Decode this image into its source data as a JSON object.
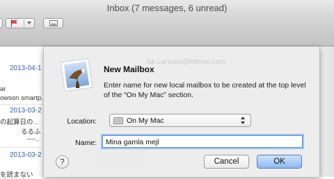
{
  "window": {
    "title": "Inbox (7 messages, 6 unread)"
  },
  "toolbar": {
    "flag_icon": "flag-icon",
    "photo_icon": "photo-browser-icon"
  },
  "message_list": {
    "items": [
      {
        "date": "2013-04-1",
        "lines": [
          "ar",
          "owson smartp..."
        ]
      },
      {
        "date": "2013-03-2",
        "lines": [
          "の起算日の…",
          "るるふ",
          "----.."
        ]
      },
      {
        "date": "2013-03-2",
        "lines": [
          "を読まない"
        ]
      }
    ]
  },
  "background": {
    "address": "lsk.Larsson@telenor.com"
  },
  "dialog": {
    "title": "New Mailbox",
    "description": "Enter name for new local mailbox to be created at the top level of the “On My Mac” section.",
    "location_label": "Location:",
    "location_value": "On My Mac",
    "name_label": "Name:",
    "name_value": "Mina gamla mejl",
    "help_label": "?",
    "cancel_label": "Cancel",
    "ok_label": "OK"
  },
  "colors": {
    "accent": "#5a90d6",
    "date_link": "#2f5fb0"
  }
}
